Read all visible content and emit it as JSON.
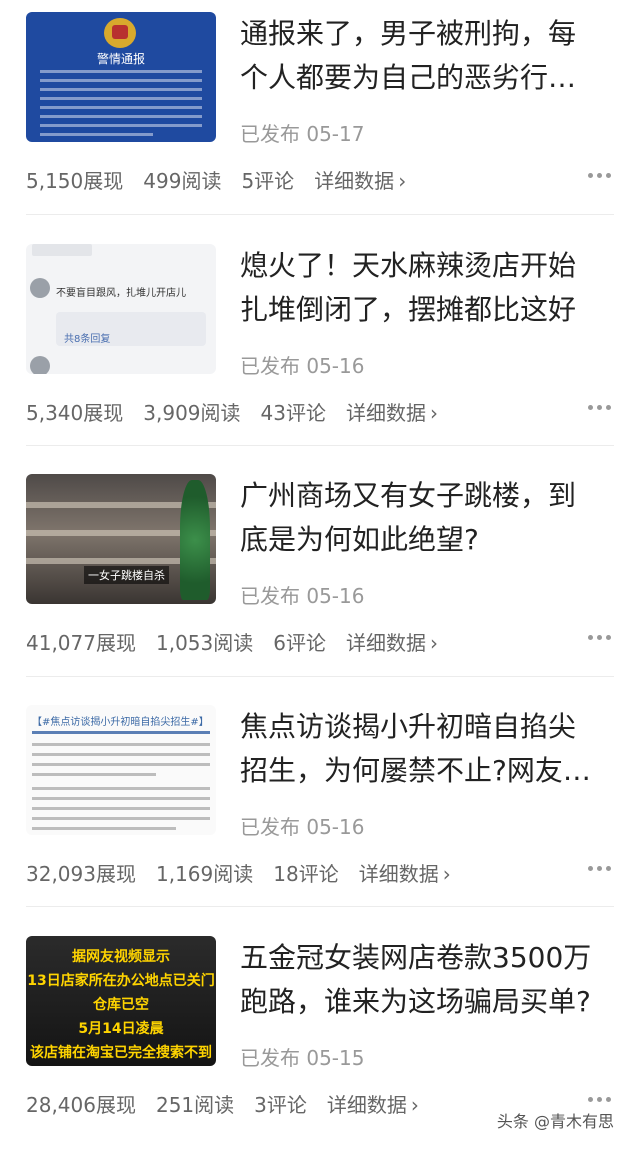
{
  "articles": [
    {
      "title": "通报来了，男子被刑拘，每个人都要为自己的恶劣行…",
      "published": "已发布 05-17",
      "views": "5,150展现",
      "reads": "499阅读",
      "comments": "5评论",
      "detail": "详细数据",
      "thumb_text": "警情通报"
    },
    {
      "title": "熄火了！天水麻辣烫店开始扎堆倒闭了，摆摊都比这好",
      "published": "已发布 05-16",
      "views": "5,340展现",
      "reads": "3,909阅读",
      "comments": "43评论",
      "detail": "详细数据",
      "thumb_text": "不要盲目跟风，扎堆儿开店儿",
      "thumb_reply": "共8条回复"
    },
    {
      "title": "广州商场又有女子跳楼，到底是为何如此绝望?",
      "published": "已发布 05-16",
      "views": "41,077展现",
      "reads": "1,053阅读",
      "comments": "6评论",
      "detail": "详细数据",
      "thumb_text": "一女子跳楼自杀"
    },
    {
      "title": "焦点访谈揭小升初暗自掐尖招生，为何屡禁不止?网友…",
      "published": "已发布 05-16",
      "views": "32,093展现",
      "reads": "1,169阅读",
      "comments": "18评论",
      "detail": "详细数据",
      "thumb_text": "【#焦点访谈揭小升初暗自掐尖招生#】"
    },
    {
      "title": "五金冠女装网店卷款3500万跑路，谁来为这场骗局买单?",
      "published": "已发布 05-15",
      "views": "28,406展现",
      "reads": "251阅读",
      "comments": "3评论",
      "detail": "详细数据",
      "thumb_lines": [
        "据网友视频显示",
        "13日店家所在办公地点已关门",
        "仓库已空",
        "5月14日凌晨",
        "该店铺在淘宝已完全搜索不到"
      ]
    }
  ],
  "watermark": "头条 @青木有思",
  "icons": {
    "chevron": "chevron-right-icon",
    "more": "more-dots-icon"
  }
}
